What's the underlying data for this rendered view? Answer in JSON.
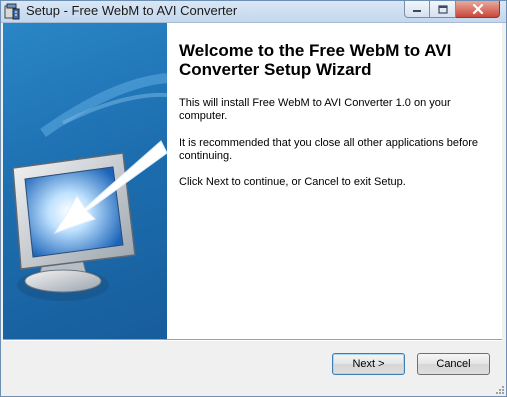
{
  "window": {
    "title": "Setup - Free WebM to AVI Converter"
  },
  "icons": {
    "app": "setup-app-icon",
    "minimize": "minimize-icon",
    "maximize": "maximize-icon",
    "close": "close-icon",
    "banner": "computer-monitor-arrow-icon"
  },
  "wizard": {
    "heading": "Welcome to the Free WebM to AVI Converter Setup Wizard",
    "paragraphs": [
      "This will install Free WebM to AVI Converter 1.0 on your computer.",
      "It is recommended that you close all other applications before continuing.",
      "Click Next to continue, or Cancel to exit Setup."
    ]
  },
  "buttons": {
    "next": "Next >",
    "cancel": "Cancel"
  },
  "colors": {
    "banner_blue": "#1d6fb0",
    "close_red": "#c9483a",
    "default_button_border": "#3c7fb1"
  }
}
